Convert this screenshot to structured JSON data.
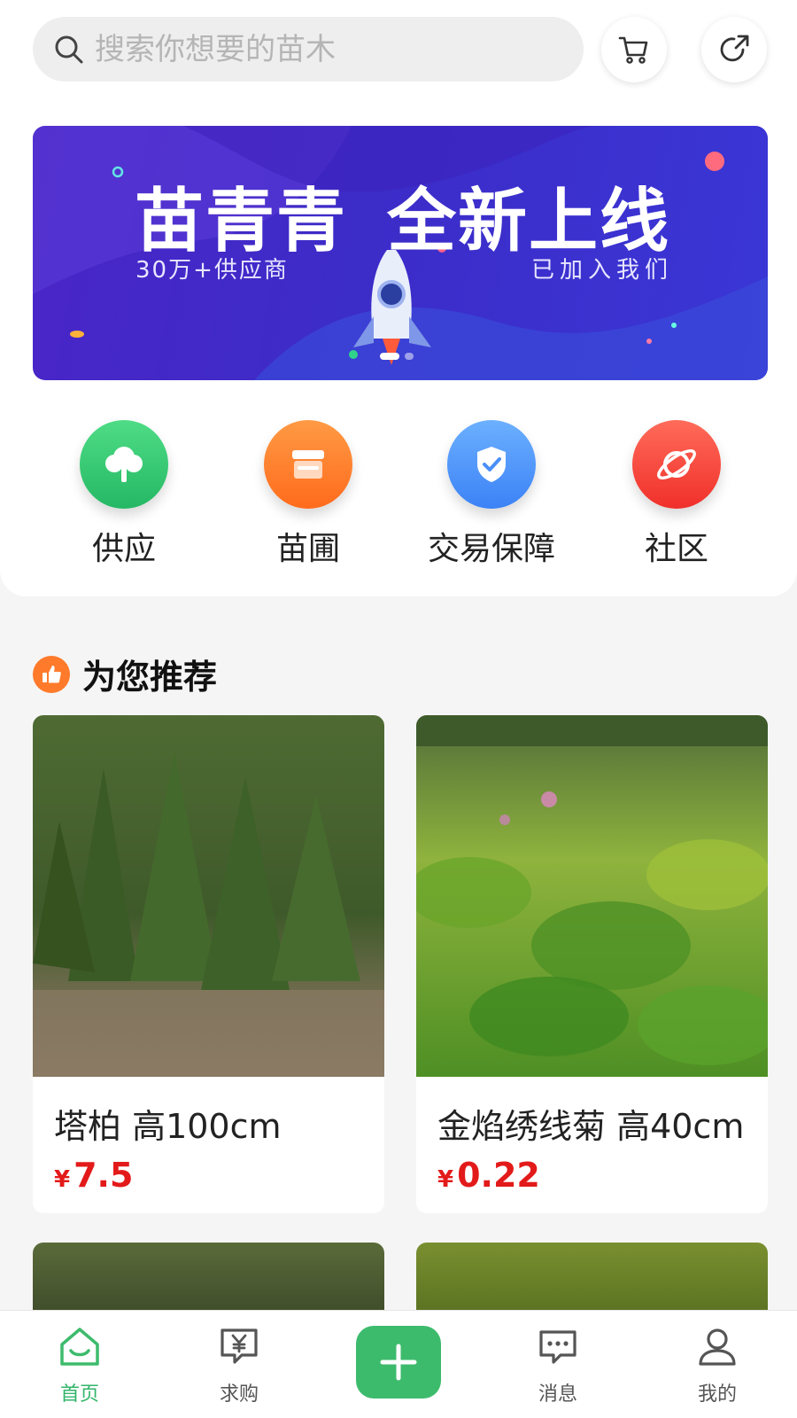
{
  "search": {
    "placeholder": "搜索你想要的苗木"
  },
  "banner": {
    "title_left": "苗青青",
    "title_right": "全新上线",
    "subtitle_left": "30万+供应商",
    "subtitle_right": "已加入我们"
  },
  "categories": [
    {
      "label": "供应",
      "icon": "tree-icon",
      "color": "#2ec26d"
    },
    {
      "label": "苗圃",
      "icon": "store-icon",
      "color": "#ff7a2a"
    },
    {
      "label": "交易保障",
      "icon": "shield-check-icon",
      "color": "#4a8ff8"
    },
    {
      "label": "社区",
      "icon": "planet-icon",
      "color": "#f23b30"
    }
  ],
  "recommend": {
    "title": "为您推荐"
  },
  "products": [
    {
      "name": "塔柏 高100cm",
      "currency": "¥",
      "price": "7.5"
    },
    {
      "name": "金焰绣线菊 高40cm",
      "currency": "¥",
      "price": "0.22"
    }
  ],
  "nav": {
    "home": "首页",
    "buy": "求购",
    "messages": "消息",
    "me": "我的"
  },
  "colors": {
    "accent_green": "#3dbb6c",
    "price_red": "#e31a1a"
  }
}
